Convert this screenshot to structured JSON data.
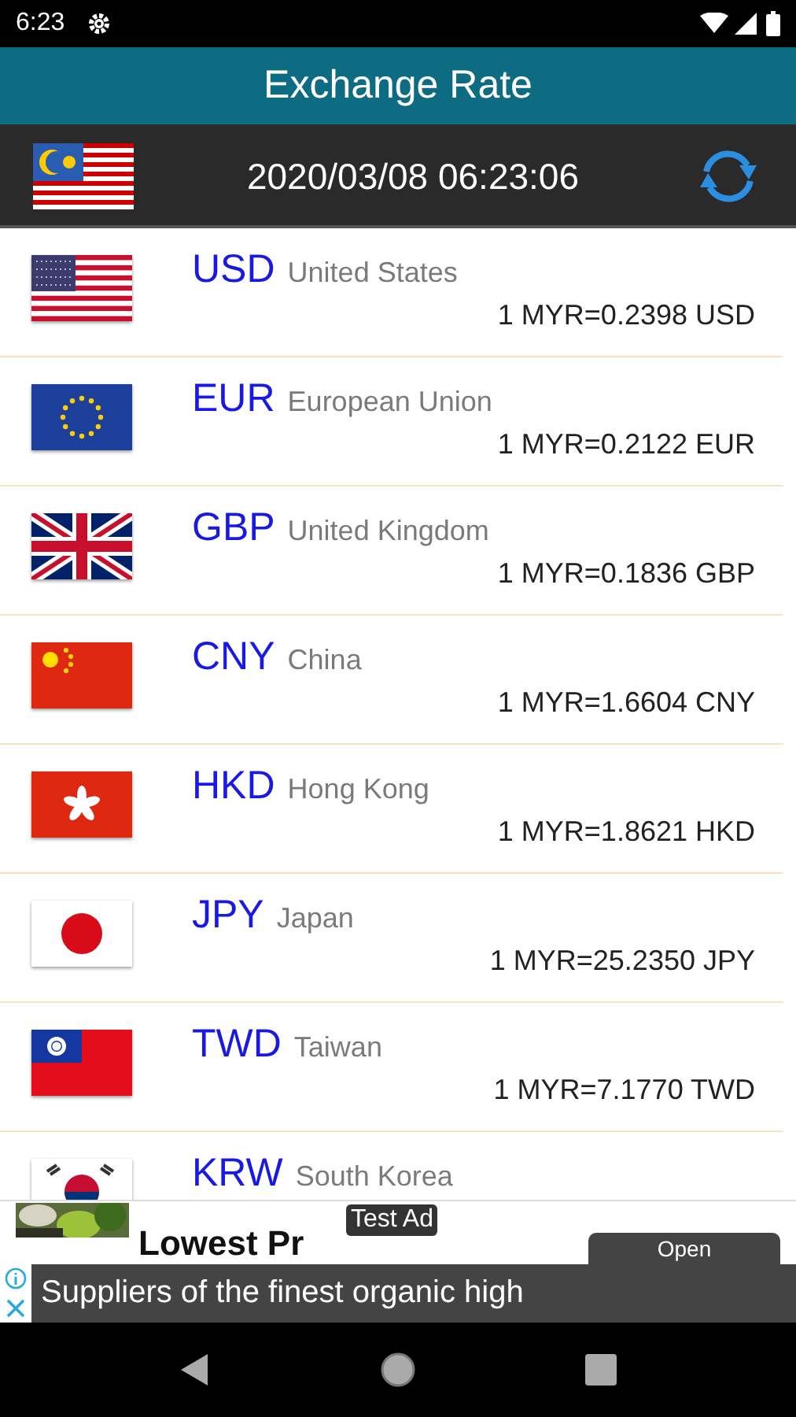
{
  "status_bar": {
    "time": "6:23"
  },
  "app_bar": {
    "title": "Exchange Rate"
  },
  "header": {
    "base_flag": {
      "kind": "my"
    },
    "timestamp": "2020/03/08 06:23:06"
  },
  "rates": [
    {
      "kind": "us",
      "code": "USD",
      "name": "United States",
      "rate": "1 MYR=0.2398 USD"
    },
    {
      "kind": "eu",
      "code": "EUR",
      "name": "European Union",
      "rate": "1 MYR=0.2122 EUR"
    },
    {
      "kind": "gb",
      "code": "GBP",
      "name": "United Kingdom",
      "rate": "1 MYR=0.1836 GBP"
    },
    {
      "kind": "cn",
      "code": "CNY",
      "name": "China",
      "rate": "1 MYR=1.6604 CNY"
    },
    {
      "kind": "hk",
      "code": "HKD",
      "name": "Hong Kong",
      "rate": "1 MYR=1.8621 HKD"
    },
    {
      "kind": "jp",
      "code": "JPY",
      "name": "Japan",
      "rate": "1 MYR=25.2350 JPY"
    },
    {
      "kind": "tw",
      "code": "TWD",
      "name": "Taiwan",
      "rate": "1 MYR=7.1770 TWD"
    },
    {
      "kind": "kr",
      "code": "KRW",
      "name": "South Korea"
    }
  ],
  "ad": {
    "headline": "Lowest Pr",
    "badge": "Test Ad",
    "button": "Open",
    "body": "Suppliers of the finest organic high"
  }
}
